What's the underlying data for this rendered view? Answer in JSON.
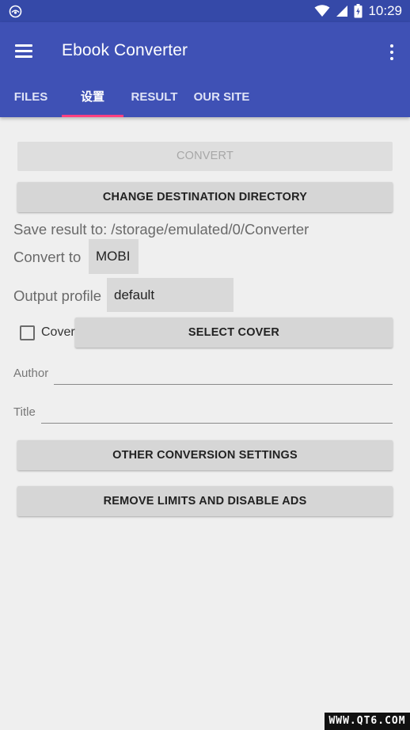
{
  "status_bar": {
    "time": "10:29",
    "icons": [
      "notification-app-icon",
      "wifi-icon",
      "cell-signal-icon",
      "battery-icon"
    ]
  },
  "app_bar": {
    "title": "Ebook Converter",
    "menu_icon": "hamburger-menu-icon",
    "overflow_icon": "more-vert-icon"
  },
  "tabs": [
    {
      "label": "FILES",
      "active": false
    },
    {
      "label": "设置",
      "active": true
    },
    {
      "label": "RESULT",
      "active": false
    },
    {
      "label": "OUR SITE",
      "active": false
    }
  ],
  "colors": {
    "primary": "#3f51b5",
    "primary_dark": "#3549a8",
    "accent": "#ff4081",
    "background": "#efefef"
  },
  "main": {
    "convert_label": "CONVERT",
    "change_dest_label": "CHANGE DESTINATION DIRECTORY",
    "save_result_text": "Save result to: /storage/emulated/0/Converter",
    "convert_to_label": "Convert to",
    "convert_to_value": "MOBI",
    "output_profile_label": "Output profile",
    "output_profile_value": "default",
    "cover_checkbox_label": "Cover",
    "cover_checked": false,
    "select_cover_label": "SELECT COVER",
    "author_label": "Author",
    "author_value": "",
    "title_label": "Title",
    "title_value": "",
    "other_settings_label": "OTHER CONVERSION SETTINGS",
    "remove_limits_label": "REMOVE LIMITS AND DISABLE ADS"
  },
  "watermark": "WWW.QT6.COM"
}
